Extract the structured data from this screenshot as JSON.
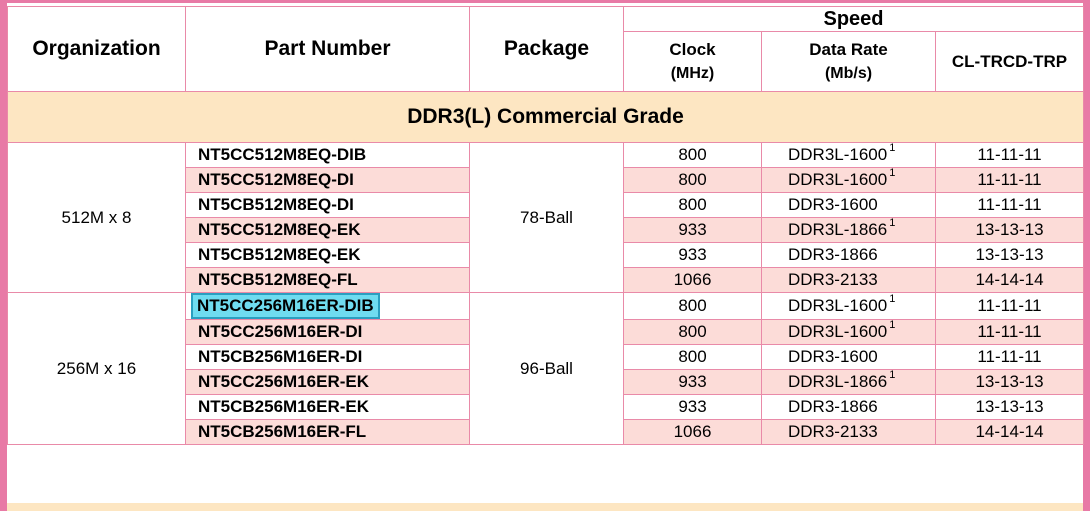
{
  "headers": {
    "organization": "Organization",
    "part_number": "Part Number",
    "package": "Package",
    "speed": "Speed",
    "clock_line1": "Clock",
    "clock_line2": "(MHz)",
    "data_rate_line1": "Data Rate",
    "data_rate_line2": "(Mb/s)",
    "cl": "CL-TRCD-TRP"
  },
  "grade_title": "DDR3(L) Commercial Grade",
  "footnote_marker": "1",
  "groups": [
    {
      "organization": "512M x 8",
      "package": "78-Ball",
      "rows": [
        {
          "part": "NT5CC512M8EQ-DIB",
          "clock": "800",
          "data_rate": "DDR3L-1600",
          "footnote": true,
          "cl": "11-11-11"
        },
        {
          "part": "NT5CC512M8EQ-DI",
          "clock": "800",
          "data_rate": "DDR3L-1600",
          "footnote": true,
          "cl": "11-11-11"
        },
        {
          "part": "NT5CB512M8EQ-DI",
          "clock": "800",
          "data_rate": "DDR3-1600",
          "footnote": false,
          "cl": "11-11-11"
        },
        {
          "part": "NT5CC512M8EQ-EK",
          "clock": "933",
          "data_rate": "DDR3L-1866",
          "footnote": true,
          "cl": "13-13-13"
        },
        {
          "part": "NT5CB512M8EQ-EK",
          "clock": "933",
          "data_rate": "DDR3-1866",
          "footnote": false,
          "cl": "13-13-13"
        },
        {
          "part": "NT5CB512M8EQ-FL",
          "clock": "1066",
          "data_rate": "DDR3-2133",
          "footnote": false,
          "cl": "14-14-14"
        }
      ]
    },
    {
      "organization": "256M x 16",
      "package": "96-Ball",
      "rows": [
        {
          "part": "NT5CC256M16ER-DIB",
          "clock": "800",
          "data_rate": "DDR3L-1600",
          "footnote": true,
          "cl": "11-11-11"
        },
        {
          "part": "NT5CC256M16ER-DI",
          "clock": "800",
          "data_rate": "DDR3L-1600",
          "footnote": true,
          "cl": "11-11-11"
        },
        {
          "part": "NT5CB256M16ER-DI",
          "clock": "800",
          "data_rate": "DDR3-1600",
          "footnote": false,
          "cl": "11-11-11"
        },
        {
          "part": "NT5CC256M16ER-EK",
          "clock": "933",
          "data_rate": "DDR3L-1866",
          "footnote": true,
          "cl": "13-13-13"
        },
        {
          "part": "NT5CB256M16ER-EK",
          "clock": "933",
          "data_rate": "DDR3-1866",
          "footnote": false,
          "cl": "13-13-13"
        },
        {
          "part": "NT5CB256M16ER-FL",
          "clock": "1066",
          "data_rate": "DDR3-2133",
          "footnote": false,
          "cl": "14-14-14"
        }
      ]
    }
  ],
  "colors": {
    "border_pink": "#e87aa6",
    "row_pink": "#fcdcd8",
    "grade_band": "#fde6c2",
    "highlight": "#6fdcf0"
  }
}
